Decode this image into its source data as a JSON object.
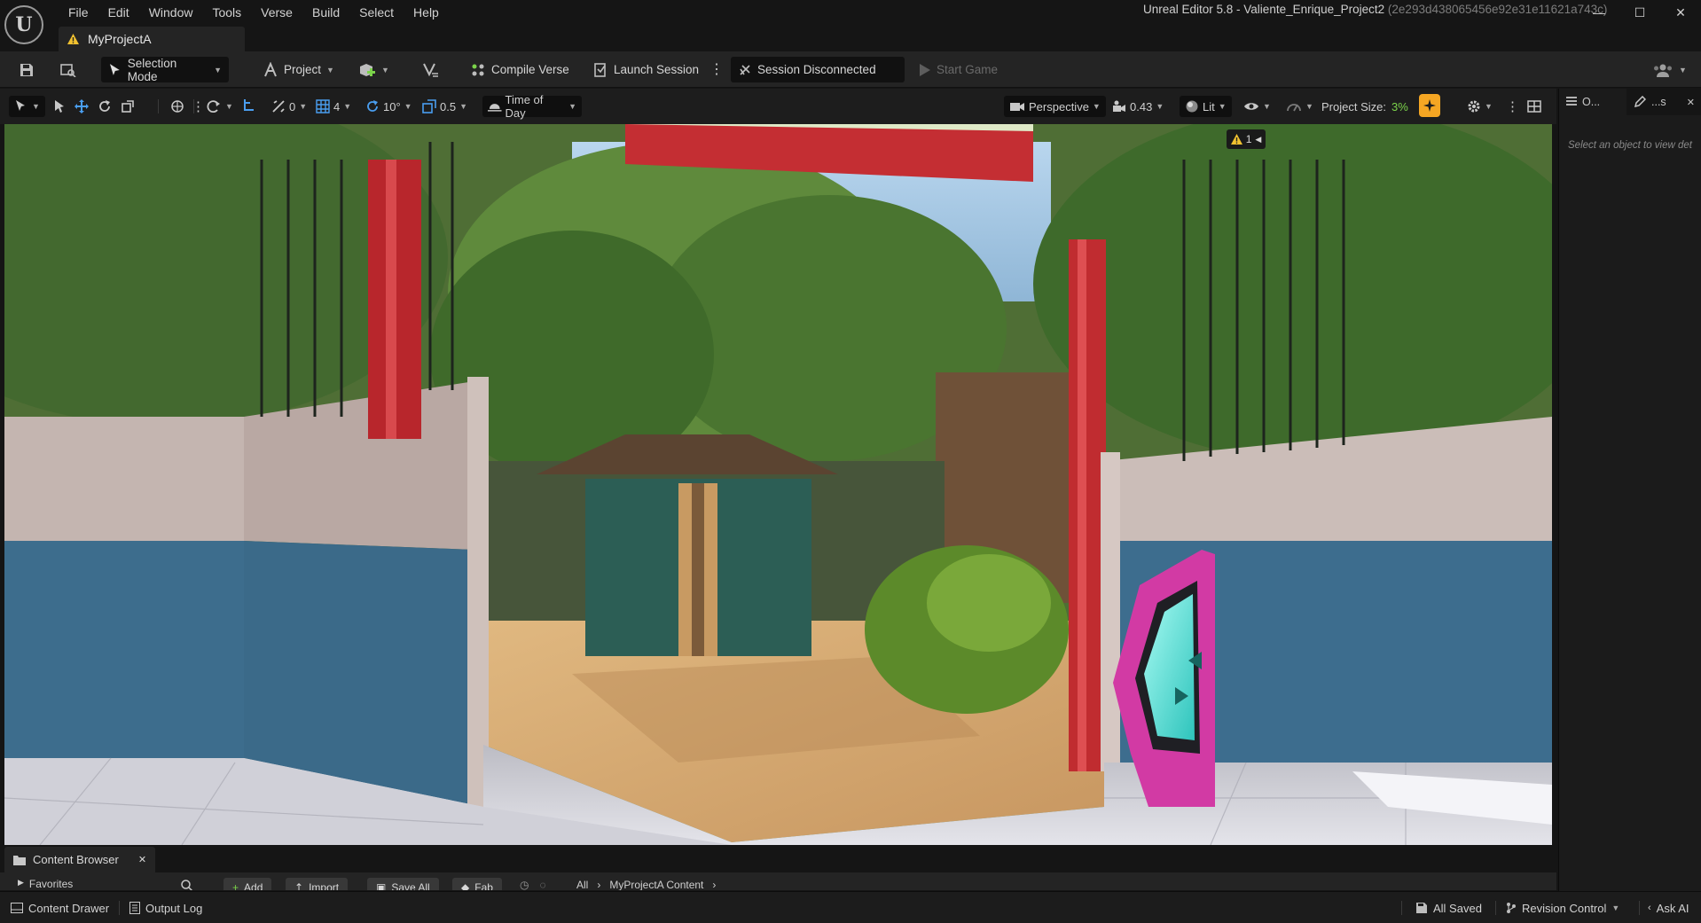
{
  "window": {
    "title": "Unreal Editor 5.8 - Valiente_Enrique_Project2",
    "hash": "(2e293d438065456e92e31e11621a743c)",
    "minimize": "—",
    "maximize": "☐",
    "close": "✕"
  },
  "logo_text": "U",
  "menu": [
    "File",
    "Edit",
    "Window",
    "Tools",
    "Verse",
    "Build",
    "Select",
    "Help"
  ],
  "project_tab": {
    "label": "MyProjectA"
  },
  "toolbar": {
    "selection_mode": "Selection Mode",
    "project": "Project",
    "compile_verse": "Compile Verse",
    "launch_session": "Launch Session",
    "session_status": "Session Disconnected",
    "start_game": "Start Game"
  },
  "viewport_toolbar": {
    "rotation_snap_value": "0",
    "grid_snap_value": "4",
    "angle_snap_value": "10°",
    "scale_snap_value": "0.5",
    "time_of_day": "Time of Day",
    "perspective": "Perspective",
    "camera_speed": "0.43",
    "lit": "Lit",
    "project_size_label": "Project Size:",
    "project_size_value": "3%",
    "warning_count": "1"
  },
  "right_panel": {
    "tab1": "O...",
    "tab2": "...s",
    "message": "Select an object to view det"
  },
  "content_browser": {
    "tab_label": "Content Browser",
    "buttons": [
      "Add",
      "Import",
      "Save All",
      "Fab"
    ],
    "favorites": "Favorites",
    "path": [
      "All",
      "MyProjectA Content"
    ]
  },
  "statusbar": {
    "content_drawer": "Content Drawer",
    "output_log": "Output Log",
    "all_saved": "All Saved",
    "revision_control": "Revision Control",
    "ask_ai": "Ask AI"
  },
  "colors": {
    "accent_green": "#7bd34a",
    "accent_orange": "#f5a623",
    "warning_yellow": "#f2c230"
  }
}
